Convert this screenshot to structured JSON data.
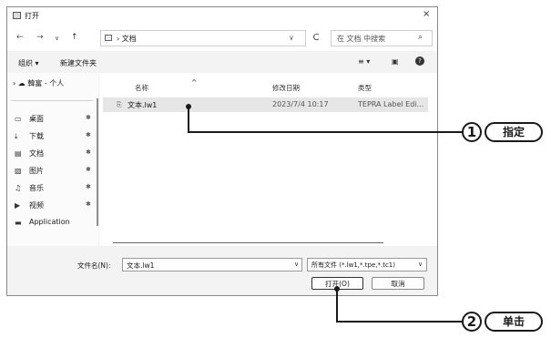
{
  "dialog": {
    "title": "打开",
    "close": "×"
  },
  "nav": {
    "back": "←",
    "forward": "→",
    "history": "∨",
    "up": "↑",
    "address": "› 文档",
    "address_caret": "∨",
    "refresh": "C",
    "search_placeholder": "在 文档 中搜索",
    "search_icon": "⌕"
  },
  "toolbar": {
    "organize": "组织 ▾",
    "new_folder": "新建文件夹",
    "view_icon": "≡ ▾",
    "pane_icon": "▣",
    "help_icon": "?"
  },
  "sidebar": {
    "root": "› ☁ 韓富 - 个人",
    "items": [
      {
        "label": "桌面",
        "glyph": "▭",
        "icon": "desktop-icon"
      },
      {
        "label": "下载",
        "glyph": "⤓",
        "icon": "download-icon"
      },
      {
        "label": "文档",
        "glyph": "▤",
        "icon": "document-icon"
      },
      {
        "label": "图片",
        "glyph": "▨",
        "icon": "picture-icon"
      },
      {
        "label": "音乐",
        "glyph": "♫",
        "icon": "music-icon"
      },
      {
        "label": "视频",
        "glyph": "▶",
        "icon": "video-icon"
      },
      {
        "label": "Application",
        "glyph": "▬",
        "icon": "folder-icon"
      }
    ],
    "pin": "✱"
  },
  "files": {
    "columns": [
      "名称",
      "修改日期",
      "类型"
    ],
    "sort_indicator": "^",
    "rows": [
      {
        "name": "文本.lw1",
        "date": "2023/7/4 10:17",
        "type": "TEPRA Label Edi..."
      }
    ]
  },
  "bottom": {
    "filename_label": "文件名(N):",
    "filename_value": "文本.lw1",
    "filter_value": "所有文件 (*.lw1,*.tpe,*.tc1)",
    "open_button": "打开(O)",
    "cancel_button": "取消"
  },
  "callouts": [
    {
      "number": "1",
      "label": "指定"
    },
    {
      "number": "2",
      "label": "单击"
    }
  ]
}
